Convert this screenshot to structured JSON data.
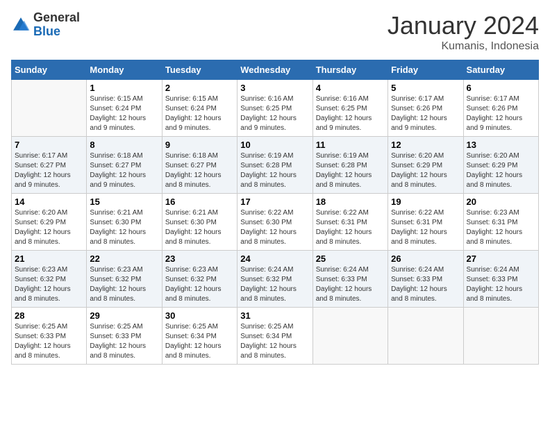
{
  "header": {
    "logo_general": "General",
    "logo_blue": "Blue",
    "month_title": "January 2024",
    "location": "Kumanis, Indonesia"
  },
  "weekdays": [
    "Sunday",
    "Monday",
    "Tuesday",
    "Wednesday",
    "Thursday",
    "Friday",
    "Saturday"
  ],
  "weeks": [
    [
      {
        "day": "",
        "sunrise": "",
        "sunset": "",
        "daylight": ""
      },
      {
        "day": "1",
        "sunrise": "Sunrise: 6:15 AM",
        "sunset": "Sunset: 6:24 PM",
        "daylight": "Daylight: 12 hours and 9 minutes."
      },
      {
        "day": "2",
        "sunrise": "Sunrise: 6:15 AM",
        "sunset": "Sunset: 6:24 PM",
        "daylight": "Daylight: 12 hours and 9 minutes."
      },
      {
        "day": "3",
        "sunrise": "Sunrise: 6:16 AM",
        "sunset": "Sunset: 6:25 PM",
        "daylight": "Daylight: 12 hours and 9 minutes."
      },
      {
        "day": "4",
        "sunrise": "Sunrise: 6:16 AM",
        "sunset": "Sunset: 6:25 PM",
        "daylight": "Daylight: 12 hours and 9 minutes."
      },
      {
        "day": "5",
        "sunrise": "Sunrise: 6:17 AM",
        "sunset": "Sunset: 6:26 PM",
        "daylight": "Daylight: 12 hours and 9 minutes."
      },
      {
        "day": "6",
        "sunrise": "Sunrise: 6:17 AM",
        "sunset": "Sunset: 6:26 PM",
        "daylight": "Daylight: 12 hours and 9 minutes."
      }
    ],
    [
      {
        "day": "7",
        "sunrise": "Sunrise: 6:17 AM",
        "sunset": "Sunset: 6:27 PM",
        "daylight": "Daylight: 12 hours and 9 minutes."
      },
      {
        "day": "8",
        "sunrise": "Sunrise: 6:18 AM",
        "sunset": "Sunset: 6:27 PM",
        "daylight": "Daylight: 12 hours and 9 minutes."
      },
      {
        "day": "9",
        "sunrise": "Sunrise: 6:18 AM",
        "sunset": "Sunset: 6:27 PM",
        "daylight": "Daylight: 12 hours and 8 minutes."
      },
      {
        "day": "10",
        "sunrise": "Sunrise: 6:19 AM",
        "sunset": "Sunset: 6:28 PM",
        "daylight": "Daylight: 12 hours and 8 minutes."
      },
      {
        "day": "11",
        "sunrise": "Sunrise: 6:19 AM",
        "sunset": "Sunset: 6:28 PM",
        "daylight": "Daylight: 12 hours and 8 minutes."
      },
      {
        "day": "12",
        "sunrise": "Sunrise: 6:20 AM",
        "sunset": "Sunset: 6:29 PM",
        "daylight": "Daylight: 12 hours and 8 minutes."
      },
      {
        "day": "13",
        "sunrise": "Sunrise: 6:20 AM",
        "sunset": "Sunset: 6:29 PM",
        "daylight": "Daylight: 12 hours and 8 minutes."
      }
    ],
    [
      {
        "day": "14",
        "sunrise": "Sunrise: 6:20 AM",
        "sunset": "Sunset: 6:29 PM",
        "daylight": "Daylight: 12 hours and 8 minutes."
      },
      {
        "day": "15",
        "sunrise": "Sunrise: 6:21 AM",
        "sunset": "Sunset: 6:30 PM",
        "daylight": "Daylight: 12 hours and 8 minutes."
      },
      {
        "day": "16",
        "sunrise": "Sunrise: 6:21 AM",
        "sunset": "Sunset: 6:30 PM",
        "daylight": "Daylight: 12 hours and 8 minutes."
      },
      {
        "day": "17",
        "sunrise": "Sunrise: 6:22 AM",
        "sunset": "Sunset: 6:30 PM",
        "daylight": "Daylight: 12 hours and 8 minutes."
      },
      {
        "day": "18",
        "sunrise": "Sunrise: 6:22 AM",
        "sunset": "Sunset: 6:31 PM",
        "daylight": "Daylight: 12 hours and 8 minutes."
      },
      {
        "day": "19",
        "sunrise": "Sunrise: 6:22 AM",
        "sunset": "Sunset: 6:31 PM",
        "daylight": "Daylight: 12 hours and 8 minutes."
      },
      {
        "day": "20",
        "sunrise": "Sunrise: 6:23 AM",
        "sunset": "Sunset: 6:31 PM",
        "daylight": "Daylight: 12 hours and 8 minutes."
      }
    ],
    [
      {
        "day": "21",
        "sunrise": "Sunrise: 6:23 AM",
        "sunset": "Sunset: 6:32 PM",
        "daylight": "Daylight: 12 hours and 8 minutes."
      },
      {
        "day": "22",
        "sunrise": "Sunrise: 6:23 AM",
        "sunset": "Sunset: 6:32 PM",
        "daylight": "Daylight: 12 hours and 8 minutes."
      },
      {
        "day": "23",
        "sunrise": "Sunrise: 6:23 AM",
        "sunset": "Sunset: 6:32 PM",
        "daylight": "Daylight: 12 hours and 8 minutes."
      },
      {
        "day": "24",
        "sunrise": "Sunrise: 6:24 AM",
        "sunset": "Sunset: 6:32 PM",
        "daylight": "Daylight: 12 hours and 8 minutes."
      },
      {
        "day": "25",
        "sunrise": "Sunrise: 6:24 AM",
        "sunset": "Sunset: 6:33 PM",
        "daylight": "Daylight: 12 hours and 8 minutes."
      },
      {
        "day": "26",
        "sunrise": "Sunrise: 6:24 AM",
        "sunset": "Sunset: 6:33 PM",
        "daylight": "Daylight: 12 hours and 8 minutes."
      },
      {
        "day": "27",
        "sunrise": "Sunrise: 6:24 AM",
        "sunset": "Sunset: 6:33 PM",
        "daylight": "Daylight: 12 hours and 8 minutes."
      }
    ],
    [
      {
        "day": "28",
        "sunrise": "Sunrise: 6:25 AM",
        "sunset": "Sunset: 6:33 PM",
        "daylight": "Daylight: 12 hours and 8 minutes."
      },
      {
        "day": "29",
        "sunrise": "Sunrise: 6:25 AM",
        "sunset": "Sunset: 6:33 PM",
        "daylight": "Daylight: 12 hours and 8 minutes."
      },
      {
        "day": "30",
        "sunrise": "Sunrise: 6:25 AM",
        "sunset": "Sunset: 6:34 PM",
        "daylight": "Daylight: 12 hours and 8 minutes."
      },
      {
        "day": "31",
        "sunrise": "Sunrise: 6:25 AM",
        "sunset": "Sunset: 6:34 PM",
        "daylight": "Daylight: 12 hours and 8 minutes."
      },
      {
        "day": "",
        "sunrise": "",
        "sunset": "",
        "daylight": ""
      },
      {
        "day": "",
        "sunrise": "",
        "sunset": "",
        "daylight": ""
      },
      {
        "day": "",
        "sunrise": "",
        "sunset": "",
        "daylight": ""
      }
    ]
  ]
}
